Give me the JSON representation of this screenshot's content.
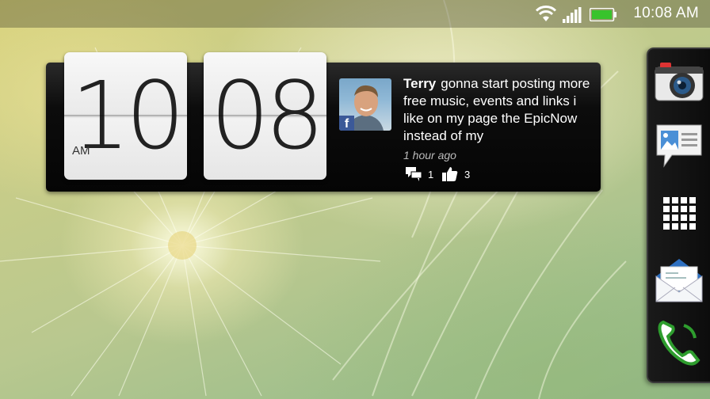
{
  "status_bar": {
    "time": "10:08 AM",
    "icons": [
      "wifi-icon",
      "signal-icon",
      "battery-icon"
    ],
    "battery_color": "#38c32c"
  },
  "clock_widget": {
    "hours": "10",
    "minutes": "08",
    "ampm": "AM"
  },
  "social_post": {
    "avatar_icon": "facebook-icon",
    "author": "Terry",
    "text": "gonna start  posting more free music, events and links i like on my page the EpicNow instead of my",
    "time_ago": "1 hour ago",
    "comments": "1",
    "likes": "3"
  },
  "dock": {
    "items": [
      "camera-icon",
      "messages-icon",
      "app-drawer-icon",
      "mail-icon",
      "phone-icon"
    ]
  }
}
